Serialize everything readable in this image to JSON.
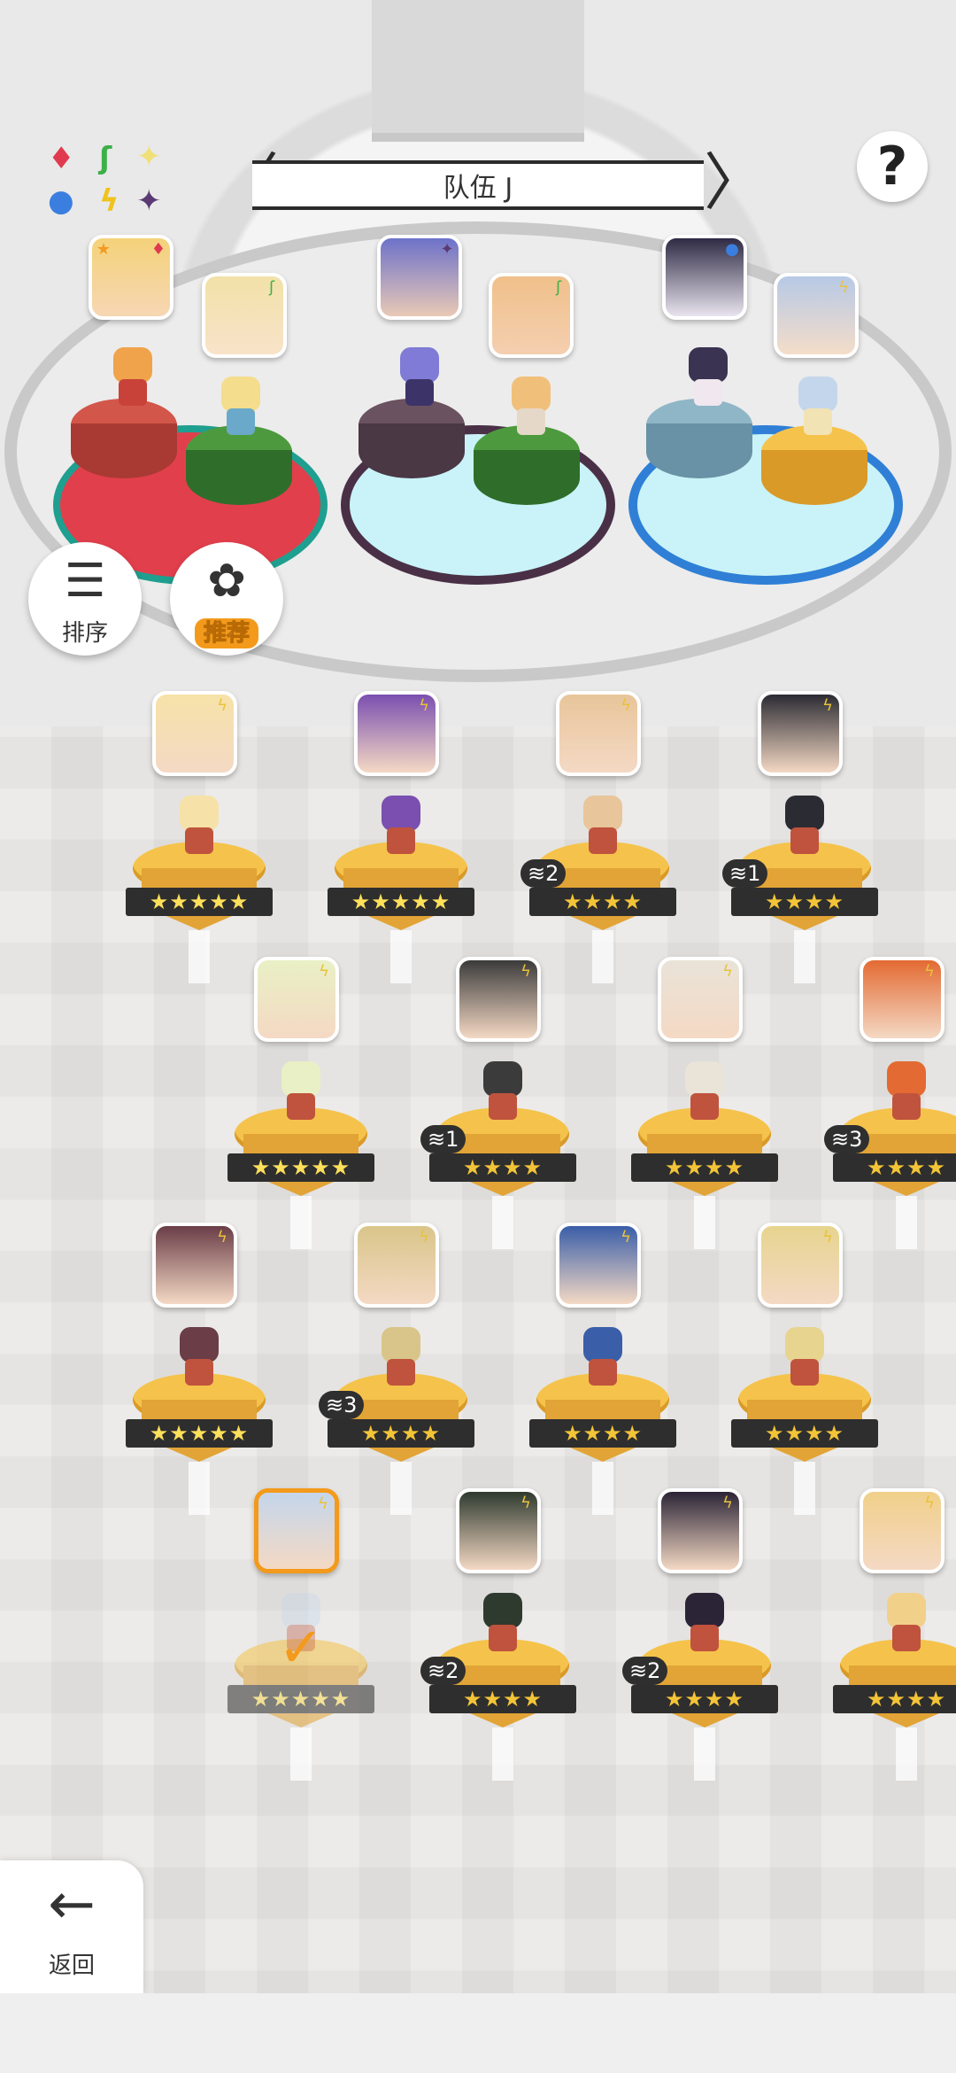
{
  "team": {
    "title": "队伍 J",
    "prev_label": "〈",
    "next_label": "〉"
  },
  "help": {
    "label": "?"
  },
  "affinity_chart": {
    "symbols": [
      "♦",
      "ʃ",
      "✦",
      "●",
      "ϟ",
      "✦"
    ],
    "colors": [
      "#e03a4e",
      "#3db04a",
      "#f1e06b",
      "#3a7fe0",
      "#f0c21c",
      "#5b3a73"
    ]
  },
  "sort_button": {
    "label": "排序",
    "icon": "sort-icon"
  },
  "recommend_button": {
    "label": "推荐",
    "icon": "recommend-icon"
  },
  "back_button": {
    "label": "返回",
    "icon": "back-arrow-icon"
  },
  "team_slots": [
    {
      "element": "fire",
      "color": "#c8423a"
    },
    {
      "element": "dark",
      "color": "#5a4550"
    },
    {
      "element": "water",
      "color": "#6aa3b8"
    }
  ],
  "roster": {
    "row1": [
      {
        "stars": "★★★★★",
        "rainbow": true,
        "copies": ""
      },
      {
        "stars": "★★★★★",
        "rainbow": true,
        "copies": ""
      },
      {
        "stars": "★★★★",
        "rainbow": false,
        "copies": "2"
      },
      {
        "stars": "★★★★",
        "rainbow": false,
        "copies": "1"
      }
    ],
    "row2": [
      {
        "stars": "★★★★★",
        "rainbow": true,
        "copies": ""
      },
      {
        "stars": "★★★★",
        "rainbow": false,
        "copies": "1"
      },
      {
        "stars": "★★★★",
        "rainbow": false,
        "copies": ""
      },
      {
        "stars": "★★★★",
        "rainbow": false,
        "copies": "3"
      }
    ],
    "row3": [
      {
        "stars": "★★★★★",
        "rainbow": true,
        "copies": ""
      },
      {
        "stars": "★★★★",
        "rainbow": false,
        "copies": "3"
      },
      {
        "stars": "★★★★",
        "rainbow": false,
        "copies": ""
      },
      {
        "stars": "★★★★",
        "rainbow": false,
        "copies": ""
      }
    ],
    "row4": [
      {
        "stars": "★★★★★",
        "rainbow": true,
        "copies": "",
        "selected": true
      },
      {
        "stars": "★★★★",
        "rainbow": false,
        "copies": "2"
      },
      {
        "stars": "★★★★",
        "rainbow": false,
        "copies": "2"
      },
      {
        "stars": "★★★★",
        "rainbow": false,
        "copies": ""
      }
    ]
  }
}
